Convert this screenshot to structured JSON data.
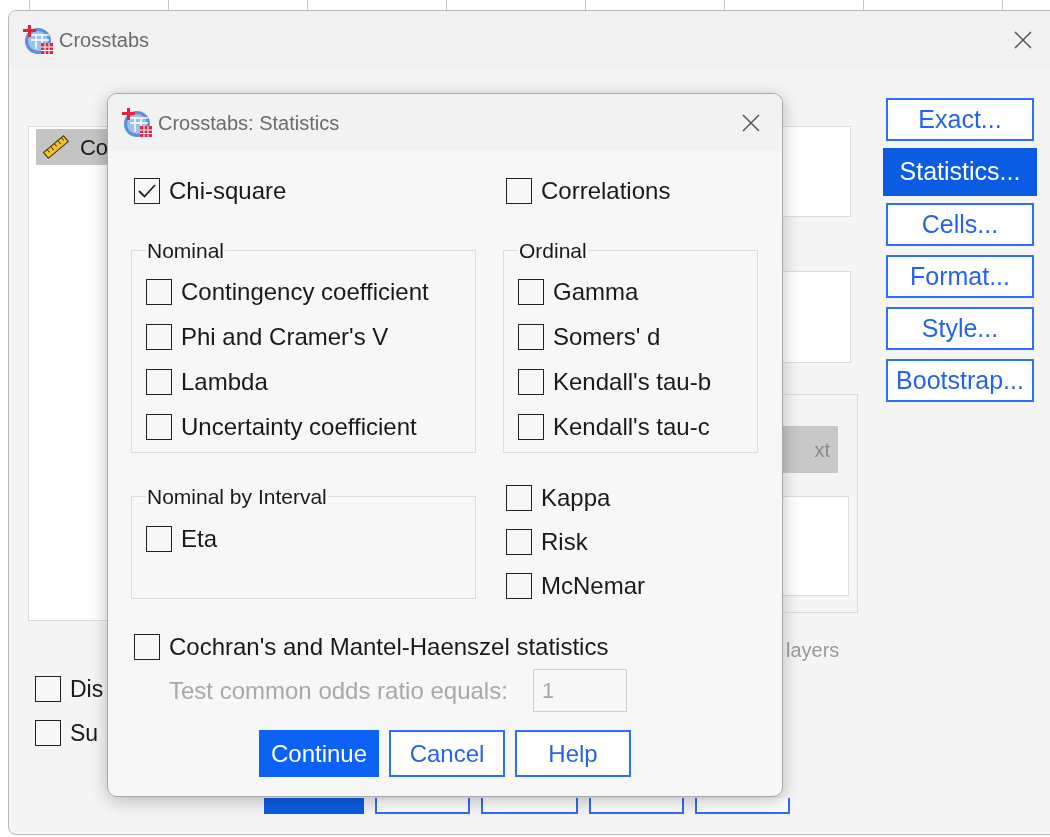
{
  "main_window": {
    "title": "Crosstabs",
    "variable_list": [
      {
        "label": "Co",
        "selected": true
      }
    ],
    "next_button": {
      "label": "xt",
      "disabled": true
    },
    "layers_label": "layers",
    "side_buttons": [
      {
        "label": "Exact...",
        "active": false
      },
      {
        "label": "Statistics...",
        "active": true
      },
      {
        "label": "Cells...",
        "active": false
      },
      {
        "label": "Format...",
        "active": false
      },
      {
        "label": "Style...",
        "active": false
      },
      {
        "label": "Bootstrap...",
        "active": false
      }
    ],
    "options": [
      {
        "label": "Dis",
        "checked": false
      },
      {
        "label": "Su",
        "checked": false
      }
    ],
    "bottom_buttons": [
      {
        "default": true
      },
      {
        "default": false
      },
      {
        "default": false
      },
      {
        "default": false
      },
      {
        "default": false
      }
    ]
  },
  "dialog": {
    "title": "Crosstabs: Statistics",
    "chi_square": {
      "label": "Chi-square",
      "checked": true
    },
    "correlations": {
      "label": "Correlations",
      "checked": false
    },
    "nominal": {
      "title": "Nominal",
      "items": [
        {
          "label": "Contingency coefficient",
          "checked": false
        },
        {
          "label": "Phi and Cramer's V",
          "checked": false
        },
        {
          "label": "Lambda",
          "checked": false
        },
        {
          "label": "Uncertainty coefficient",
          "checked": false
        }
      ]
    },
    "ordinal": {
      "title": "Ordinal",
      "items": [
        {
          "label": "Gamma",
          "checked": false
        },
        {
          "label": "Somers' d",
          "checked": false
        },
        {
          "label": "Kendall's tau-b",
          "checked": false
        },
        {
          "label": "Kendall's tau-c",
          "checked": false
        }
      ]
    },
    "nominal_by_interval": {
      "title": "Nominal by Interval",
      "items": [
        {
          "label": "Eta",
          "checked": false
        }
      ]
    },
    "other_measures": [
      {
        "label": "Kappa",
        "checked": false
      },
      {
        "label": "Risk",
        "checked": false
      },
      {
        "label": "McNemar",
        "checked": false
      }
    ],
    "cochran": {
      "label": "Cochran's and Mantel-Haenszel statistics",
      "checked": false
    },
    "odds_ratio": {
      "label": "Test common odds ratio equals:",
      "value": "1",
      "disabled": true
    },
    "buttons": [
      {
        "label": "Continue",
        "default": true
      },
      {
        "label": "Cancel",
        "default": false
      },
      {
        "label": "Help",
        "default": false
      }
    ]
  }
}
